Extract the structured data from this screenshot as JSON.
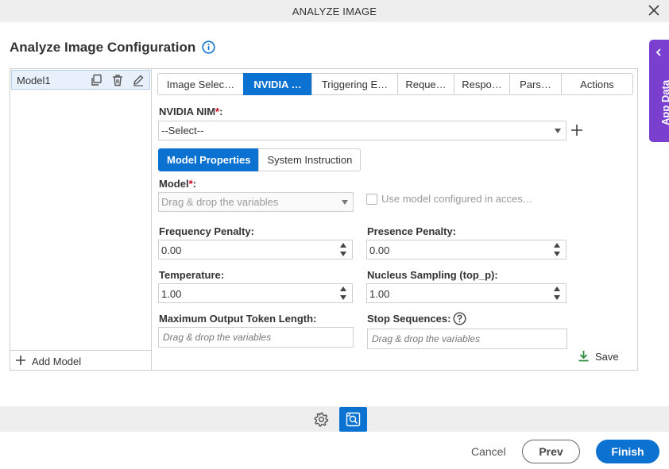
{
  "window": {
    "title": "ANALYZE IMAGE"
  },
  "page": {
    "heading": "Analyze Image Configuration"
  },
  "app_data": {
    "label": "App Data"
  },
  "models": {
    "items": [
      {
        "name": "Model1"
      }
    ],
    "add_label": "Add Model"
  },
  "tabs": [
    {
      "label": "Image Selec…",
      "active": false
    },
    {
      "label": "NVIDIA …",
      "active": true
    },
    {
      "label": "Triggering E…",
      "active": false
    },
    {
      "label": "Reque…",
      "active": false
    },
    {
      "label": "Respo…",
      "active": false
    },
    {
      "label": "Pars…",
      "active": false
    },
    {
      "label": "Actions",
      "active": false
    }
  ],
  "nvidia_nim": {
    "label": "NVIDIA NIM",
    "required_mark": "*",
    "suffix": ":",
    "value": "--Select--"
  },
  "subtabs": [
    {
      "label": "Model Properties",
      "active": true
    },
    {
      "label": "System Instruction",
      "active": false
    }
  ],
  "model_field": {
    "label": "Model",
    "required_mark": "*",
    "suffix": ":",
    "placeholder": "Drag & drop the variables"
  },
  "use_model_checkbox": {
    "label": "Use model configured in acces…",
    "checked": false
  },
  "frequency_penalty": {
    "label": "Frequency Penalty:",
    "value": "0.00"
  },
  "presence_penalty": {
    "label": "Presence Penalty:",
    "value": "0.00"
  },
  "temperature": {
    "label": "Temperature:",
    "value": "1.00"
  },
  "nucleus_sampling": {
    "label": "Nucleus Sampling (top_p):",
    "value": "1.00"
  },
  "max_output_token": {
    "label": "Maximum Output Token Length:",
    "placeholder": "Drag & drop the variables"
  },
  "stop_sequences": {
    "label": "Stop Sequences:",
    "placeholder": "Drag & drop the variables"
  },
  "save_label": "Save",
  "footer": {
    "cancel": "Cancel",
    "prev": "Prev",
    "finish": "Finish"
  },
  "colors": {
    "accent": "#0b72d1",
    "app_data": "#7b3fcf",
    "required": "#d0021b",
    "save_icon": "#2e8b3e"
  }
}
